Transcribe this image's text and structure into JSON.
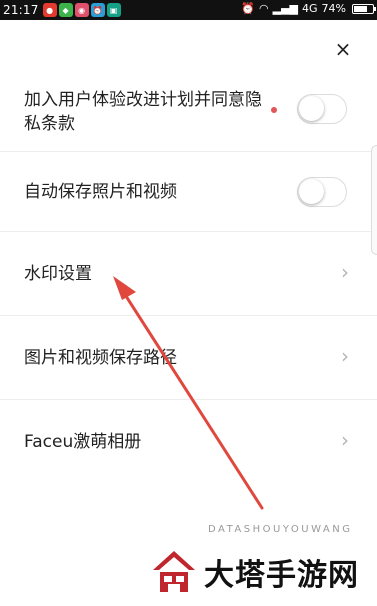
{
  "status_bar": {
    "time": "21:17",
    "network": "4G",
    "battery_percent": "74%",
    "battery_level": 0.74,
    "app_icons": [
      "weibo-icon",
      "wechat-icon",
      "app-icon",
      "clock-icon",
      "scan-icon"
    ]
  },
  "close_label": "×",
  "settings": [
    {
      "label": "加入用户体验改进计划并同意隐私条款",
      "type": "toggle",
      "on": false,
      "has_dot": true
    },
    {
      "label": "自动保存照片和视频",
      "type": "toggle",
      "on": false
    },
    {
      "label": "水印设置",
      "type": "link"
    },
    {
      "label": "图片和视频保存路径",
      "type": "link"
    },
    {
      "label": "Faceu激萌相册",
      "type": "link"
    }
  ],
  "chevron": "›",
  "watermark": {
    "text": "大塔手游网",
    "sub": "DATASHOUYOUWANG"
  },
  "colors": {
    "accent_red": "#e2535a",
    "arrow": "#e0483e"
  }
}
